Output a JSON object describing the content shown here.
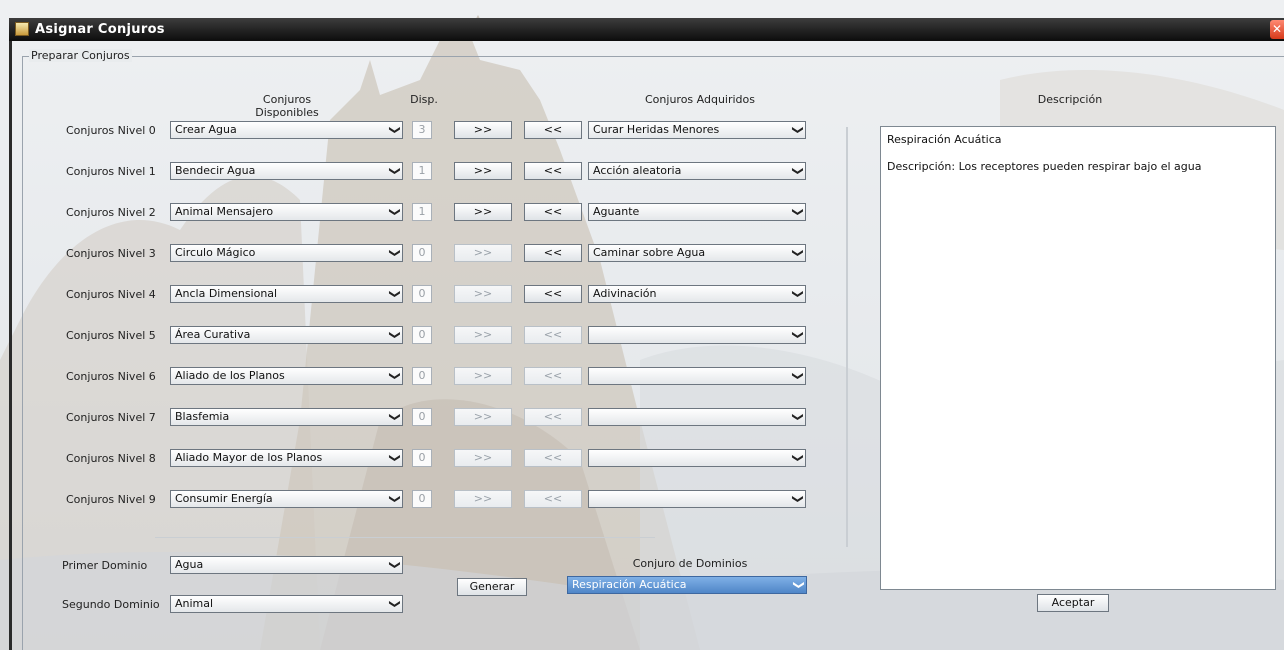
{
  "window": {
    "title": "Asignar Conjuros"
  },
  "panel": {
    "legend": "Preparar Conjuros"
  },
  "headers": {
    "disponibles": "Conjuros Disponibles",
    "disp": "Disp.",
    "adquiridos": "Conjuros Adquiridos",
    "descripcion": "Descripción"
  },
  "buttons": {
    "add": ">>",
    "remove": "<<",
    "generar": "Generar",
    "aceptar": "Aceptar"
  },
  "levels": [
    {
      "label": "Conjuros Nivel 0",
      "available": "Crear Agua",
      "count": "3",
      "acquired": "Curar Heridas Menores",
      "add_enabled": true,
      "remove_enabled": true
    },
    {
      "label": "Conjuros Nivel 1",
      "available": "Bendecir Agua",
      "count": "1",
      "acquired": "Acción aleatoria",
      "add_enabled": true,
      "remove_enabled": true
    },
    {
      "label": "Conjuros Nivel 2",
      "available": "Animal Mensajero",
      "count": "1",
      "acquired": "Aguante",
      "add_enabled": true,
      "remove_enabled": true
    },
    {
      "label": "Conjuros Nivel 3",
      "available": "Circulo Mágico",
      "count": "0",
      "acquired": "Caminar sobre Agua",
      "add_enabled": false,
      "remove_enabled": true
    },
    {
      "label": "Conjuros Nivel 4",
      "available": "Ancla Dimensional",
      "count": "0",
      "acquired": "Adivinación",
      "add_enabled": false,
      "remove_enabled": true
    },
    {
      "label": "Conjuros Nivel 5",
      "available": "Área Curativa",
      "count": "0",
      "acquired": "",
      "add_enabled": false,
      "remove_enabled": false
    },
    {
      "label": "Conjuros Nivel 6",
      "available": "Aliado de los Planos",
      "count": "0",
      "acquired": "",
      "add_enabled": false,
      "remove_enabled": false
    },
    {
      "label": "Conjuros Nivel 7",
      "available": "Blasfemia",
      "count": "0",
      "acquired": "",
      "add_enabled": false,
      "remove_enabled": false
    },
    {
      "label": "Conjuros Nivel 8",
      "available": "Aliado Mayor de los Planos",
      "count": "0",
      "acquired": "",
      "add_enabled": false,
      "remove_enabled": false
    },
    {
      "label": "Conjuros Nivel 9",
      "available": "Consumir Energía",
      "count": "0",
      "acquired": "",
      "add_enabled": false,
      "remove_enabled": false
    }
  ],
  "dominios": {
    "primer_label": "Primer Dominio",
    "primer_value": "Agua",
    "segundo_label": "Segundo Dominio",
    "segundo_value": "Animal",
    "conjuro_label": "Conjuro de Dominios",
    "conjuro_value": "Respiración Acuática"
  },
  "description": {
    "title": "Respiración Acuática",
    "text": "Descripción: Los receptores pueden respirar bajo el agua"
  }
}
